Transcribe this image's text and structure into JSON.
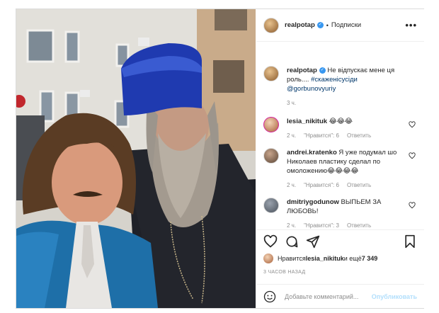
{
  "header": {
    "username": "realpotap",
    "separator": "•",
    "follow_label": "Подписки",
    "more_label": "•••"
  },
  "caption": {
    "username": "realpotap",
    "text": " Не відпускає мене ця роль.... ",
    "hashtag": "#скаженісусіди",
    "mention": "@gorbunovyuriy",
    "time": "3 ч."
  },
  "comments": [
    {
      "username": "lesia_nikituk",
      "text": " 😂😂😂",
      "time": "2 ч.",
      "likes": "\"Нравится\": 6",
      "reply": "Ответить"
    },
    {
      "username": "andrei.kratenko",
      "text": " Я уже подумал шо Николаев пластику сделал по омоложению😂😂😂😂",
      "time": "2 ч.",
      "likes": "\"Нравится\": 6",
      "reply": "Ответить"
    },
    {
      "username": "dmitriygodunow",
      "text": " ВЫПЬЕМ ЗА ЛЮБОВЬ!",
      "time": "2 ч.",
      "likes": "\"Нравится\": 3",
      "reply": "Ответить"
    }
  ],
  "likes": {
    "prefix": "Нравится ",
    "user": "lesia_nikituk",
    "middle": " и ещё ",
    "count": "7 349"
  },
  "timestamp": "3 ЧАСОВ НАЗАД",
  "add_comment": {
    "placeholder": "Добавьте комментарий...",
    "publish_label": "Опубликовать"
  },
  "colors": {
    "link": "#00376b",
    "verified": "#3897f0",
    "muted": "#8e8e8e",
    "publish_disabled": "#b2dffc"
  },
  "icons": [
    "more-icon",
    "verified-icon",
    "heart-icon",
    "comment-icon",
    "share-icon",
    "bookmark-icon",
    "emoji-icon"
  ]
}
